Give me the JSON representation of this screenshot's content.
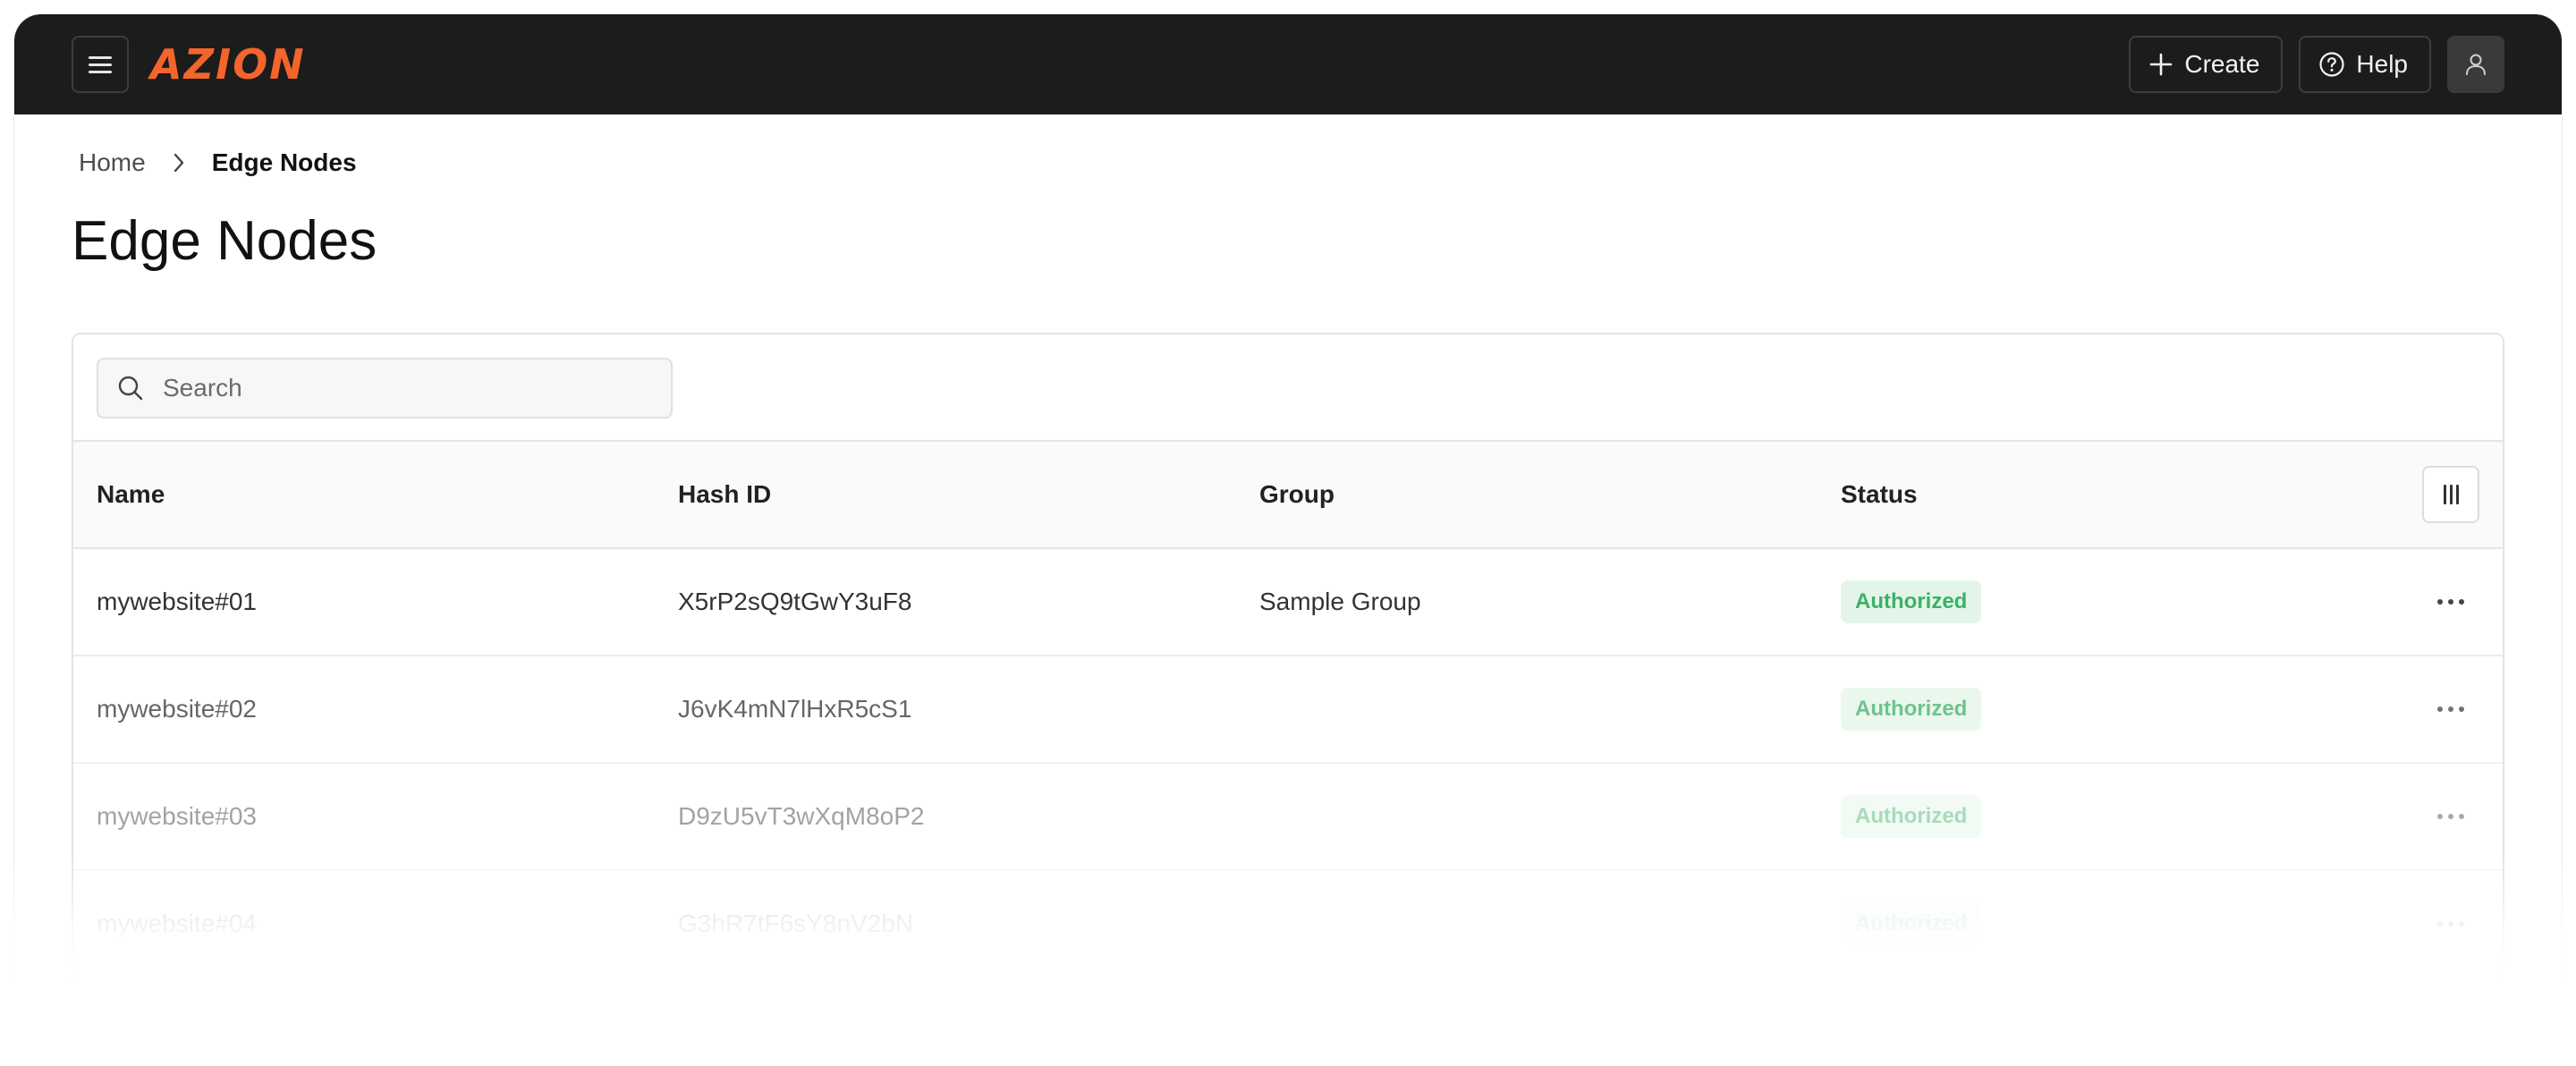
{
  "app": {
    "logo_text": "AZION",
    "brand_color": "#f3652b"
  },
  "topbar": {
    "menu_icon": "hamburger-icon",
    "create_label": "Create",
    "help_label": "Help",
    "avatar_icon": "user-icon"
  },
  "breadcrumb": {
    "home": "Home",
    "current": "Edge Nodes"
  },
  "page": {
    "title": "Edge Nodes"
  },
  "search": {
    "placeholder": "Search",
    "value": ""
  },
  "table": {
    "columns": [
      "Name",
      "Hash ID",
      "Group",
      "Status"
    ],
    "rows": [
      {
        "name": "mywebsite#01",
        "hash_id": "X5rP2sQ9tGwY3uF8",
        "group": "Sample Group",
        "status": "Authorized"
      },
      {
        "name": "mywebsite#02",
        "hash_id": "J6vK4mN7lHxR5cS1",
        "group": "",
        "status": "Authorized"
      },
      {
        "name": "mywebsite#03",
        "hash_id": "D9zU5vT3wXqM8oP2",
        "group": "",
        "status": "Authorized"
      },
      {
        "name": "mywebsite#04",
        "hash_id": "G3hR7tF6sY8nV2bN",
        "group": "",
        "status": "Authorized"
      }
    ],
    "status_color": "#3eb067"
  }
}
